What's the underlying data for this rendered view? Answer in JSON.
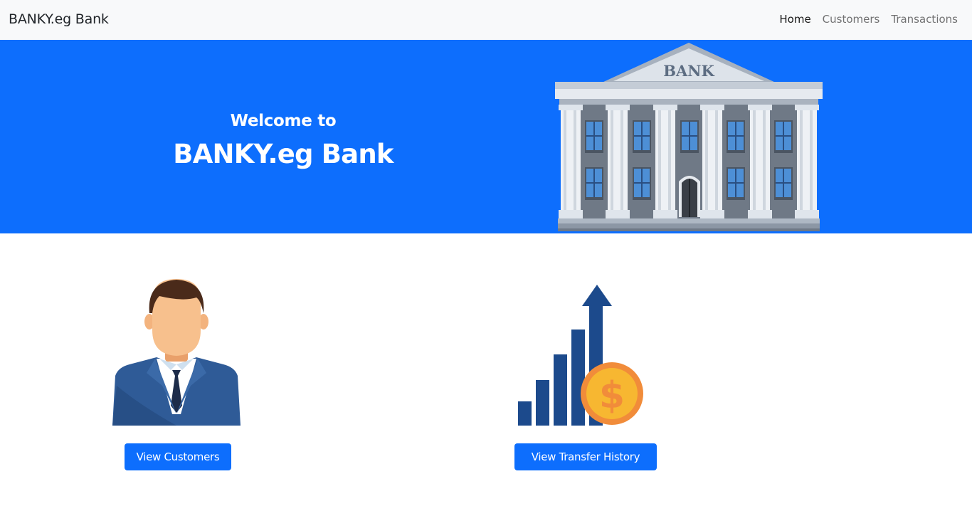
{
  "navbar": {
    "brand": "BANKY.eg Bank",
    "links": [
      {
        "label": "Home",
        "active": true
      },
      {
        "label": "Customers",
        "active": false
      },
      {
        "label": "Transactions",
        "active": false
      }
    ]
  },
  "hero": {
    "subtitle": "Welcome to",
    "title": "BANKY.eg Bank",
    "background_color": "#0d6efd",
    "illustration": {
      "icon": "bank-building-icon",
      "sign": "BANK"
    }
  },
  "cards": [
    {
      "icon": "businessman-icon",
      "button_label": "View Customers"
    },
    {
      "icon": "growth-chart-dollar-icon",
      "button_label": "View Transfer History"
    }
  ],
  "colors": {
    "primary": "#0d6efd",
    "navbar_bg": "#f8f9fa",
    "illustration_navy": "#1c4a8c",
    "coin": "#f7b731"
  }
}
